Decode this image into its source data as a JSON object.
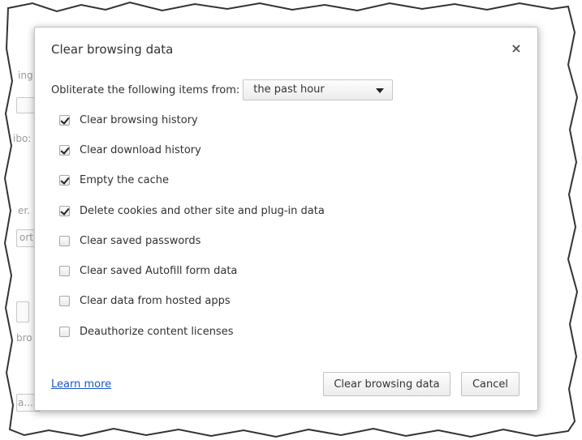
{
  "dialog": {
    "title": "Clear browsing data",
    "close_icon": "close-icon",
    "range_label": "Obliterate the following items from:",
    "range_value": "the past hour",
    "options": [
      {
        "label": "Clear browsing history",
        "checked": true
      },
      {
        "label": "Clear download history",
        "checked": true
      },
      {
        "label": "Empty the cache",
        "checked": true
      },
      {
        "label": "Delete cookies and other site and plug-in data",
        "checked": true
      },
      {
        "label": "Clear saved passwords",
        "checked": false
      },
      {
        "label": "Clear saved Autofill form data",
        "checked": false
      },
      {
        "label": "Clear data from hosted apps",
        "checked": false
      },
      {
        "label": "Deauthorize content licenses",
        "checked": false
      }
    ],
    "learn_more": "Learn more",
    "clear_button": "Clear browsing data",
    "cancel_button": "Cancel"
  },
  "background_fragments": [
    "ing",
    "ibo:",
    "er.",
    "ort",
    "bro",
    "a..."
  ]
}
